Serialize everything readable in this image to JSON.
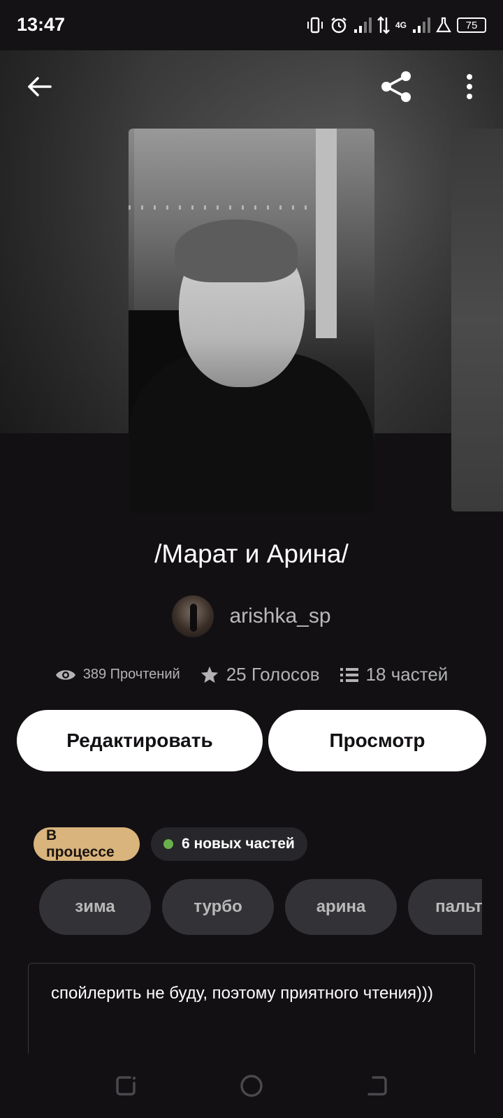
{
  "status_bar": {
    "time": "13:47",
    "network": "4G",
    "battery": "75"
  },
  "story": {
    "title": "/Марат и Арина/",
    "author": "arishka_sp",
    "stats": {
      "reads": "389 Прочтений",
      "votes": "25 Голосов",
      "parts": "18 частей"
    }
  },
  "actions": {
    "edit_label": "Редактировать",
    "preview_label": "Просмотр"
  },
  "badges": {
    "status": "В процессе",
    "new_parts": "6 новых частей"
  },
  "tags": [
    "зима",
    "турбо",
    "арина",
    "пальто"
  ],
  "description": "спойлерить не буду, поэтому приятного чтения)))",
  "colors": {
    "background": "#121013",
    "status_badge": "#d9b47d",
    "new_dot": "#6ab04c",
    "tag_bg": "#333236"
  },
  "icons": {
    "back": "arrow-left-icon",
    "share": "share-icon",
    "menu": "more-vertical-icon",
    "reads": "eye-icon",
    "votes": "star-icon",
    "parts": "list-icon"
  }
}
